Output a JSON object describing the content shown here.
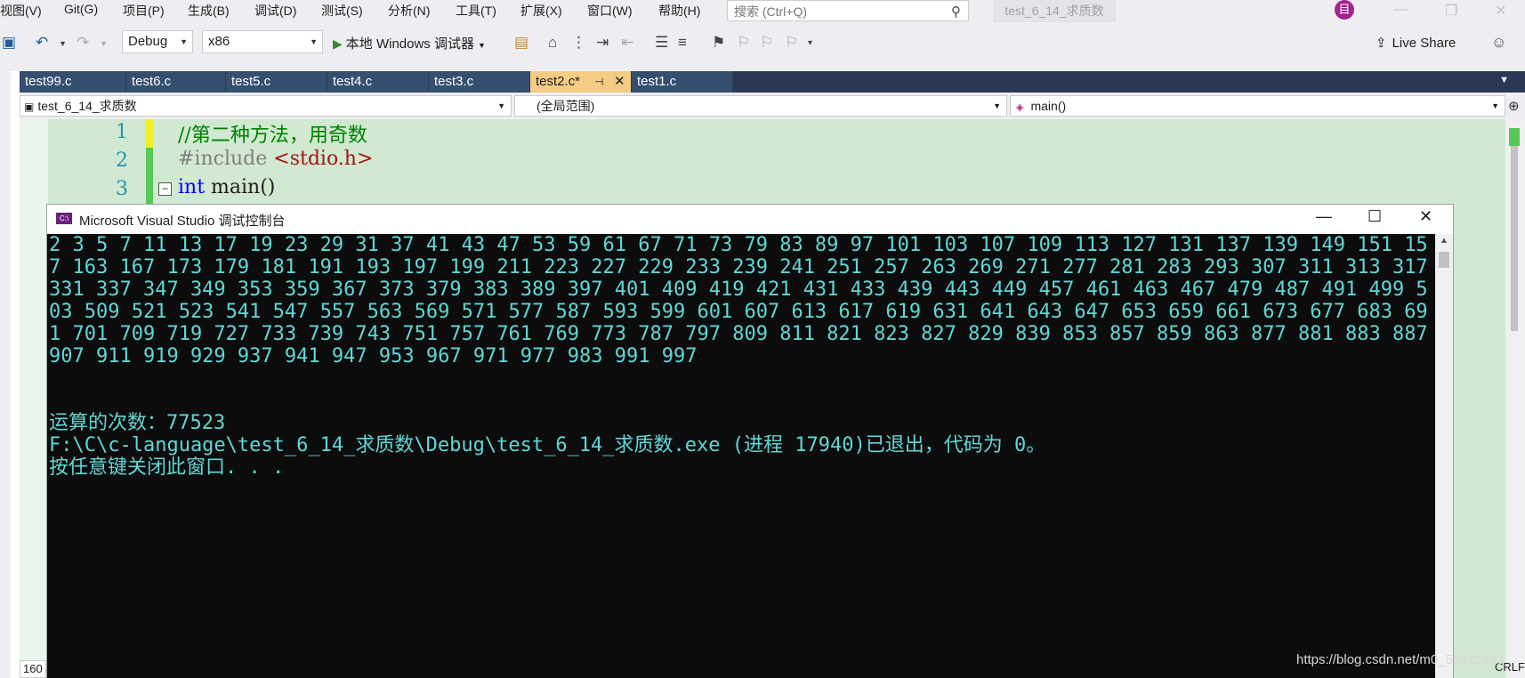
{
  "menu": [
    "视图(V)",
    "Git(G)",
    "项目(P)",
    "生成(B)",
    "调试(D)",
    "测试(S)",
    "分析(N)",
    "工具(T)",
    "扩展(X)",
    "窗口(W)",
    "帮助(H)"
  ],
  "search": {
    "placeholder": "搜索 (Ctrl+Q)"
  },
  "solution_name": "test_6_14_求质数",
  "profile_initial": "目",
  "toolbar": {
    "config": "Debug",
    "platform": "x86",
    "run_label": "本地 Windows 调试器",
    "live_share": "Live Share"
  },
  "tabs": [
    {
      "label": "test99.c"
    },
    {
      "label": "test6.c"
    },
    {
      "label": "test5.c"
    },
    {
      "label": "test4.c"
    },
    {
      "label": "test3.c"
    },
    {
      "label": "test2.c*",
      "active": true
    },
    {
      "label": "test1.c"
    }
  ],
  "navbar": {
    "project": "test_6_14_求质数",
    "scope": "(全局范围)",
    "member": "main()"
  },
  "editor": {
    "lines": [
      {
        "num": "1",
        "text": "//第二种方法，用奇数"
      },
      {
        "num": "2",
        "text": "#include <stdio.h>"
      },
      {
        "num": "3",
        "text": "int main()"
      }
    ],
    "zoom": "160",
    "line_ending": "CRLF"
  },
  "console": {
    "title": "Microsoft Visual Studio 调试控制台",
    "output": "2 3 5 7 11 13 17 19 23 29 31 37 41 43 47 53 59 61 67 71 73 79 83 89 97 101 103 107 109 113 127 131 137 139 149 151 157 163 167 173 179 181 191 193 197 199 211 223 227 229 233 239 241 251 257 263 269 271 277 281 283 293 307 311 313 317 331 337 347 349 353 359 367 373 379 383 389 397 401 409 419 421 431 433 439 443 449 457 461 463 467 479 487 491 499 503 509 521 523 541 547 557 563 569 571 577 587 593 599 601 607 613 617 619 631 641 643 647 653 659 661 673 677 683 691 701 709 719 727 733 739 743 751 757 761 769 773 787 797 809 811 821 823 827 829 839 853 857 859 863 877 881 883 887 907 911 919 929 937 941 947 953 967 971 977 983 991 997\n\n\n运算的次数：77523\nF:\\C\\c-language\\test_6_14_求质数\\Debug\\test_6_14_求质数.exe (进程 17940)已退出，代码为 0。\n按任意键关闭此窗口. . ."
  },
  "watermark": "https://blog.csdn.net/m0_56311933",
  "colors": {
    "tab_strip": "#293955",
    "tab_active": "#f5cc84",
    "editor_bg": "#d0e9d0",
    "console_bg": "#0c0c0c",
    "console_text": "#61d6d6",
    "comment": "#008000",
    "keyword": "#0000ff",
    "preprocessor": "#808080",
    "string": "#a31515",
    "line_number": "#2b91af"
  }
}
